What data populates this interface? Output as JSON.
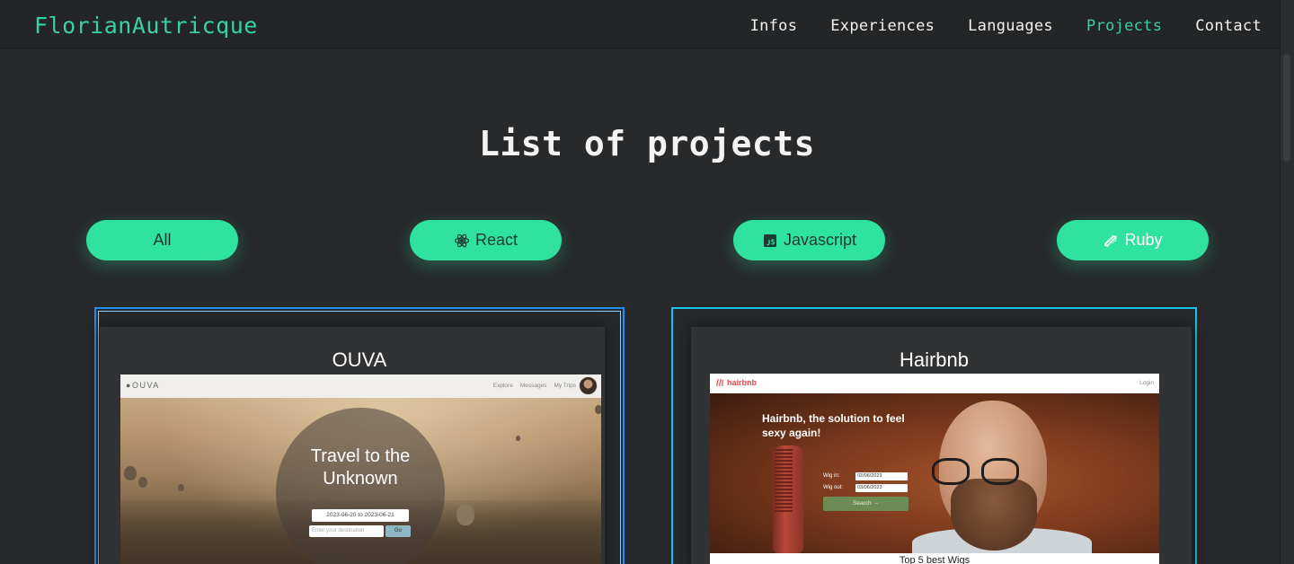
{
  "nav": {
    "brand": "FlorianAutricque",
    "links": [
      {
        "label": "Infos",
        "active": false
      },
      {
        "label": "Experiences",
        "active": false
      },
      {
        "label": "Languages",
        "active": false
      },
      {
        "label": "Projects",
        "active": true
      },
      {
        "label": "Contact",
        "active": false
      }
    ]
  },
  "title": "List of projects",
  "filters": [
    {
      "label": "All",
      "icon": ""
    },
    {
      "label": "React",
      "icon": "react-icon"
    },
    {
      "label": "Javascript",
      "icon": "javascript-icon"
    },
    {
      "label": "Ruby",
      "icon": "ruby-icon"
    }
  ],
  "projects": [
    {
      "name": "OUVA",
      "screenshot": {
        "logo": "OUVA",
        "menu": [
          "Explore",
          "Messages",
          "My Trips"
        ],
        "hero": "Travel to the Unknown",
        "date_range": "2023-06-20 to 2023-06-21",
        "destination_placeholder": "Enter your destination",
        "go_label": "Go"
      }
    },
    {
      "name": "Hairbnb",
      "screenshot": {
        "logo": "hairbnb",
        "login": "Login",
        "headline": "Hairbnb, the solution to feel sexy again!",
        "wig_in_label": "Wig in:",
        "wig_in_value": "02/06/2023",
        "wig_out_label": "Wig out:",
        "wig_out_value": "03/06/2023",
        "search_label": "Search →",
        "footer_heading": "Top 5 best Wigs"
      }
    }
  ],
  "colors": {
    "accent": "#39d0a6",
    "filter_bg": "#2fe2a0",
    "background": "#27292b",
    "card_border_selected": "#1e90ff",
    "card_border": "#1cc3e8"
  }
}
